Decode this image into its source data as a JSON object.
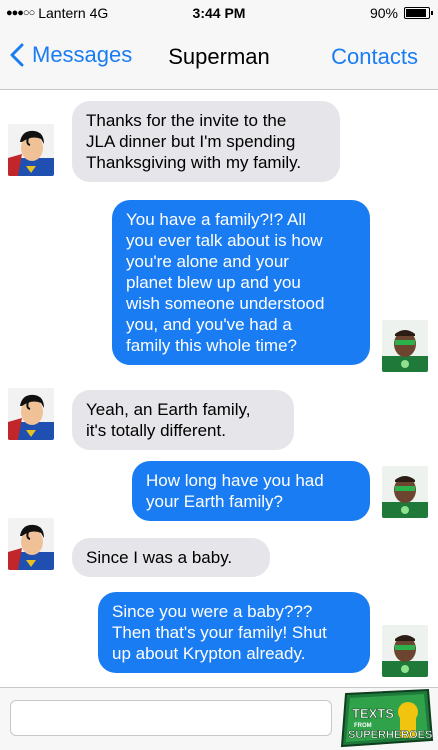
{
  "status_bar": {
    "carrier": "Lantern 4G",
    "time": "3:44 PM",
    "battery": "90%",
    "battery_level": 0.9,
    "signal_icon": "signal-dots-icon"
  },
  "nav": {
    "back_label": "Messages",
    "title": "Superman",
    "contacts_label": "Contacts"
  },
  "messages": [
    {
      "direction": "incoming",
      "lines": [
        "Thanks for the invite to the",
        "JLA dinner but I'm spending",
        "Thanksgiving with my family."
      ]
    },
    {
      "direction": "outgoing",
      "lines": [
        "You have a family?!? All",
        "you ever talk about is how",
        "you're alone and your",
        "planet blew up and you",
        "wish someone understood",
        "you, and you've had a",
        "family this whole time?"
      ]
    },
    {
      "direction": "incoming",
      "lines": [
        "Yeah, an Earth family,",
        "it's totally different."
      ]
    },
    {
      "direction": "outgoing",
      "lines": [
        "How long have you had",
        "your Earth family?"
      ]
    },
    {
      "direction": "incoming",
      "lines": [
        "Since I was a baby."
      ]
    },
    {
      "direction": "outgoing",
      "lines": [
        "Since you were a baby???",
        "Then that's your family! Shut",
        "up about Krypton already."
      ]
    }
  ],
  "input": {
    "placeholder": ""
  },
  "logo": {
    "line1": "TEXTS",
    "line2": "FROM",
    "line3": "SUPERHEROES"
  },
  "colors": {
    "outgoing": "#1a7cf2",
    "incoming": "#e5e5ea",
    "accent": "#1a7cf2"
  }
}
